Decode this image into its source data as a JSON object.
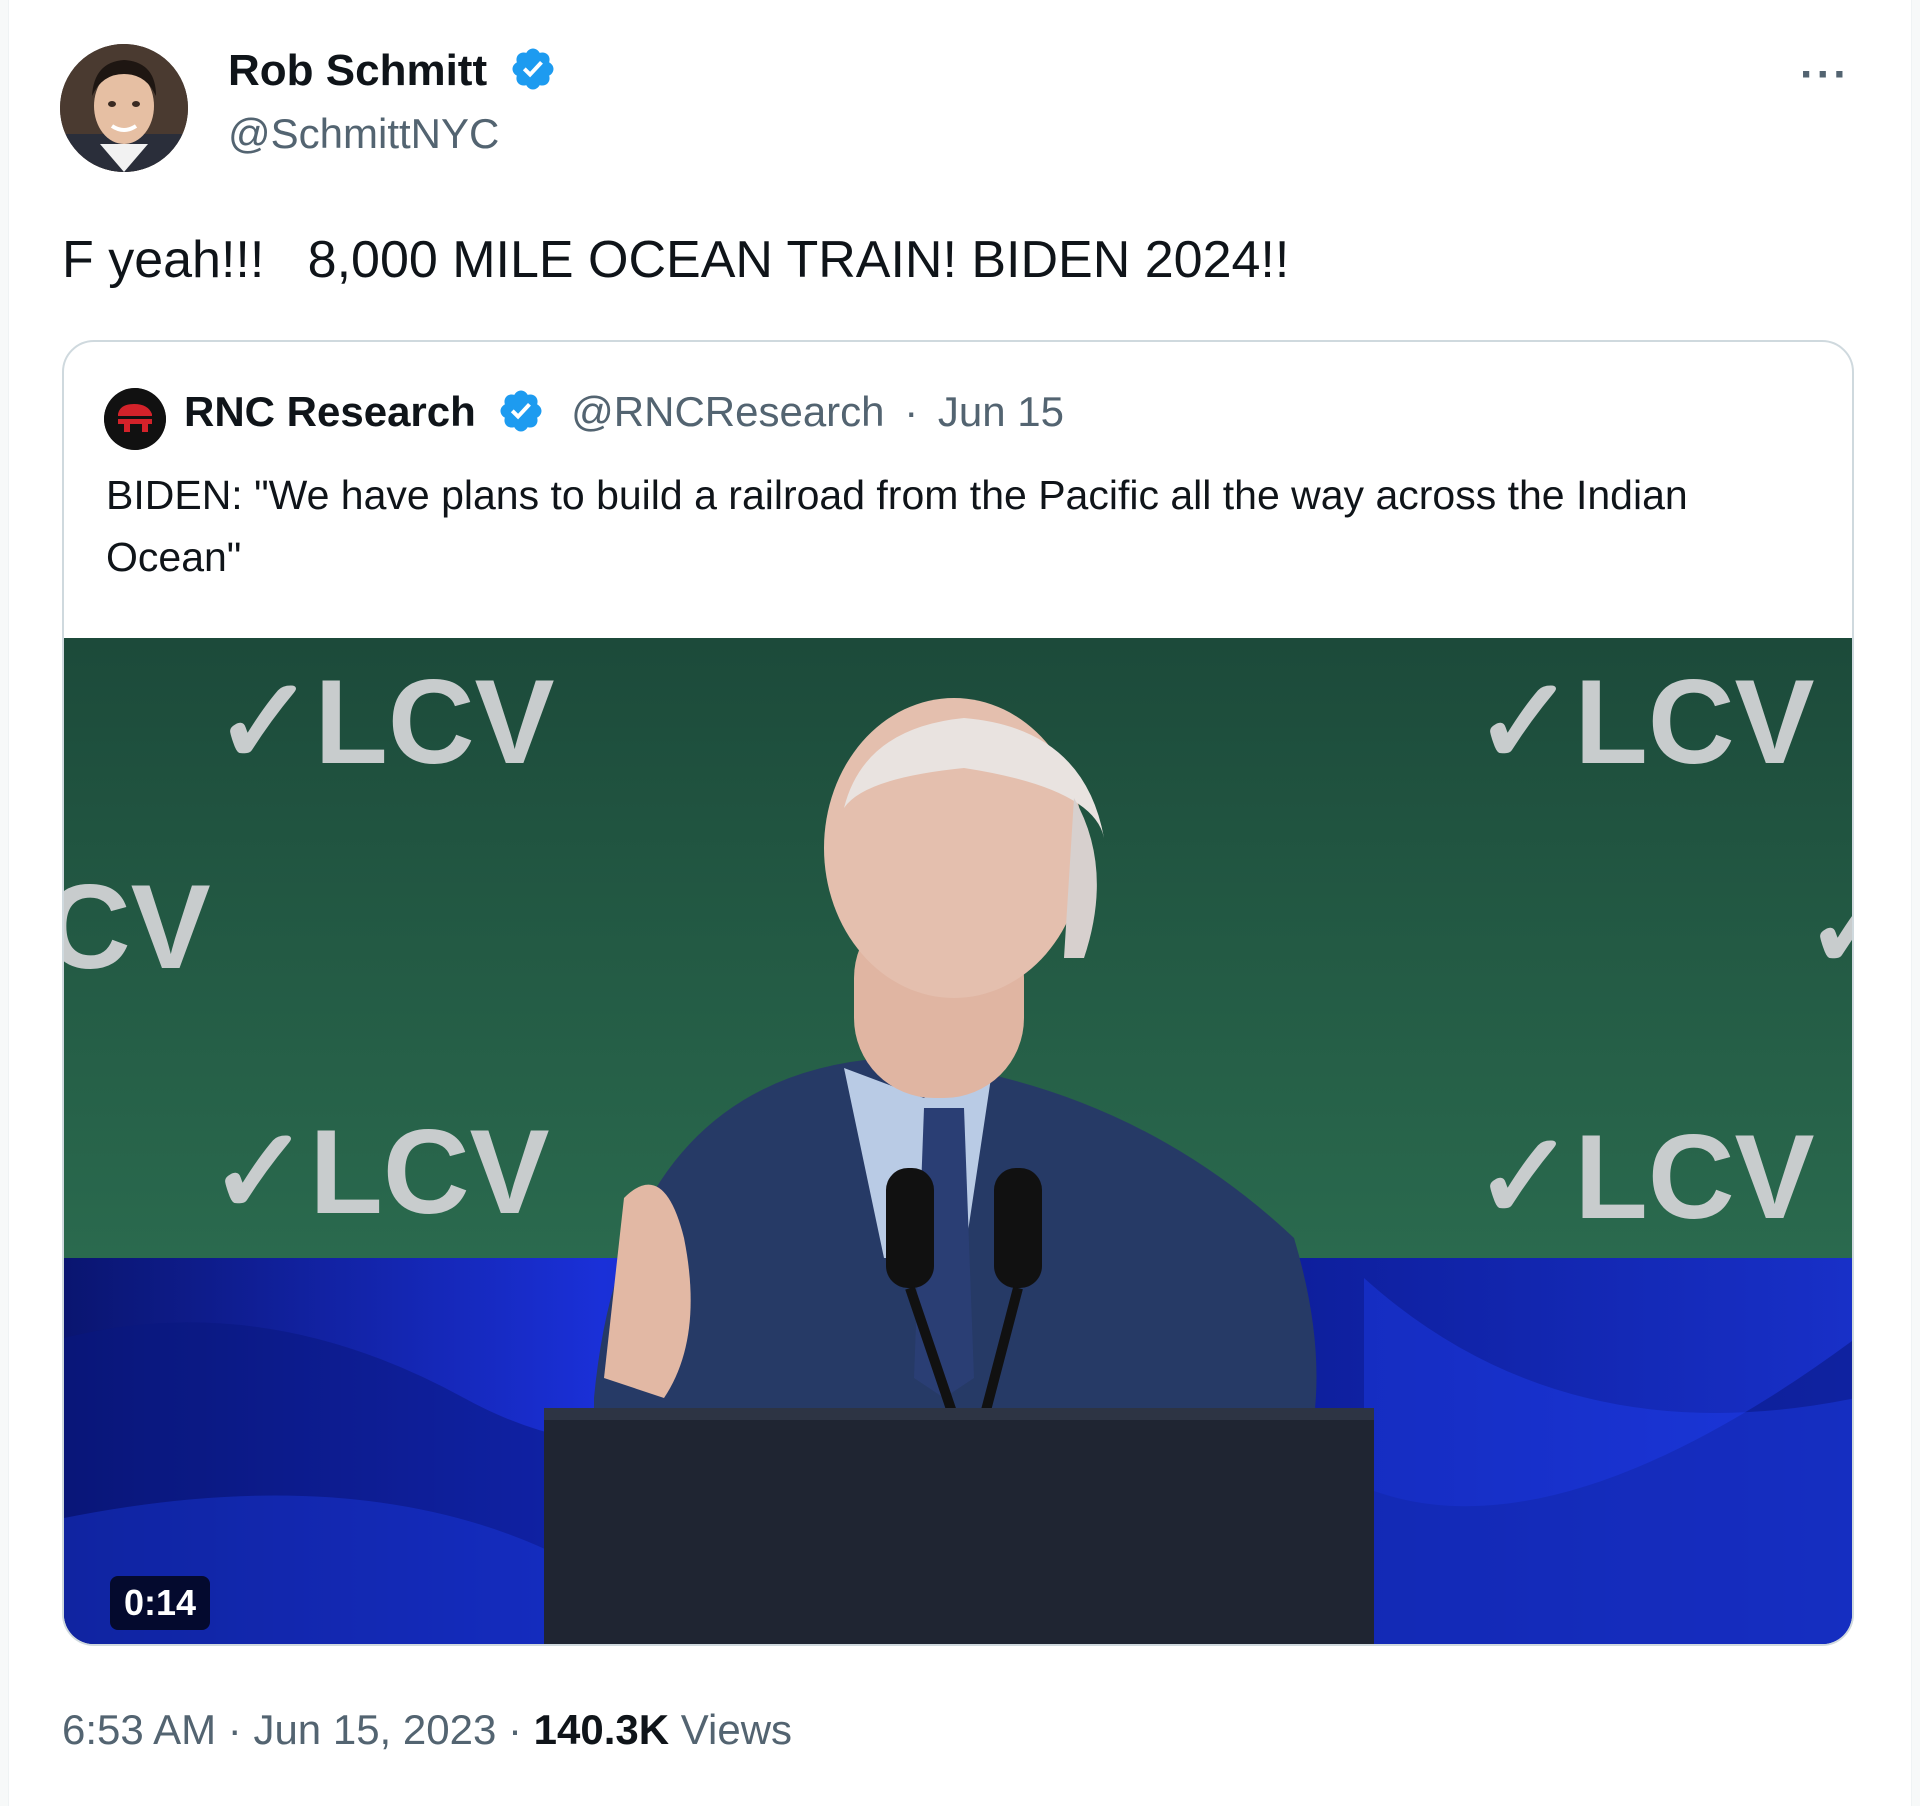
{
  "author": {
    "name": "Rob Schmitt",
    "handle": "@SchmittNYC",
    "verified": true
  },
  "menu": {
    "more_label": "···"
  },
  "tweet": {
    "text": "F yeah!!!   8,000 MILE OCEAN TRAIN! BIDEN 2024!!"
  },
  "quoted": {
    "name": "RNC Research",
    "handle": "@RNCResearch",
    "separator": "·",
    "date": "Jun 15",
    "verified": true,
    "text": "BIDEN: \"We have plans to build a railroad from the Pacific all the way across the Indian Ocean\"",
    "media": {
      "duration": "0:14",
      "backdrop_text": "✓LCV",
      "backdrop_partial_left": "CV"
    }
  },
  "meta": {
    "time": "6:53 AM",
    "sep1": "·",
    "date": "Jun 15, 2023",
    "sep2": "·",
    "views_count": "140.3K",
    "views_label": "Views"
  },
  "colors": {
    "text": "#0f1419",
    "secondary": "#536471",
    "verified_blue": "#1d9bf0",
    "border": "#cfd9de"
  }
}
